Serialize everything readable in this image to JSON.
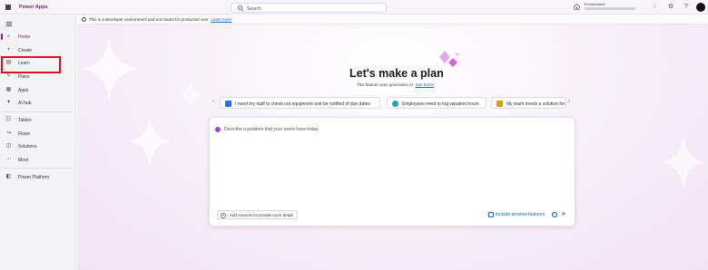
{
  "header": {
    "app_title": "Power Apps",
    "search_placeholder": "Search",
    "environment_label": "Environment",
    "icons": [
      "waffle-icon",
      "search-icon",
      "environment-icon",
      "bell-icon",
      "gear-icon",
      "help-icon",
      "avatar"
    ]
  },
  "sidebar": {
    "items": [
      {
        "label": "Home",
        "icon": "home-icon",
        "active": true
      },
      {
        "label": "Create",
        "icon": "plus-icon",
        "active": false
      },
      {
        "label": "Learn",
        "icon": "book-icon",
        "active": false
      },
      {
        "label": "Plans",
        "icon": "plans-icon",
        "active": false
      },
      {
        "label": "Apps",
        "icon": "apps-icon",
        "active": false
      },
      {
        "label": "AI hub",
        "icon": "ai-hub-icon",
        "active": false
      },
      {
        "label": "Tables",
        "icon": "table-icon",
        "active": false
      },
      {
        "label": "Flows",
        "icon": "flow-icon",
        "active": false
      },
      {
        "label": "Solutions",
        "icon": "solutions-icon",
        "active": false
      },
      {
        "label": "More",
        "icon": "more-icon",
        "active": false
      },
      {
        "label": "Power Platform",
        "icon": "power-platform-icon",
        "active": false
      }
    ]
  },
  "banner": {
    "text": "This is a developer environment and not meant for production use.",
    "link": "Learn more"
  },
  "main": {
    "heading": "Let's make a plan",
    "subline": "This feature uses generative AI.",
    "subline_link": "See terms",
    "chips": [
      {
        "label": "I need my staff to check out equipment and be notified of due dates",
        "icon_color": "#2f6fd6"
      },
      {
        "label": "Employees need to log vacation hours",
        "icon_color": "#2aa0c0"
      },
      {
        "label": "My team needs a solution for",
        "icon_color": "#d9a400"
      }
    ],
    "prompt_placeholder": "Describe a problem that your users have today.",
    "add_sources_label": "Add sources to provide more detail",
    "include_preview_label": "Include preview features"
  },
  "colors": {
    "brand": "#742774",
    "highlight": "#e0101a",
    "link": "#0f6cbd"
  }
}
